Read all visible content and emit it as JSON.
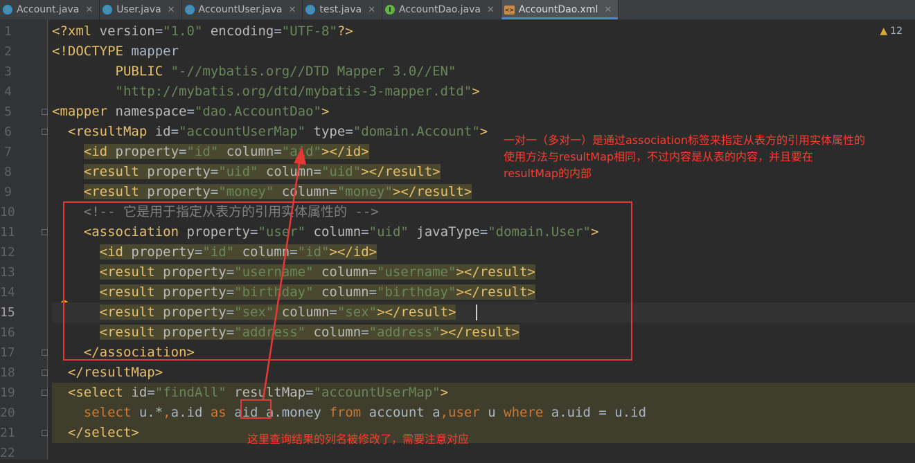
{
  "tabs": [
    {
      "label": "Account.java",
      "icon": "class-c-icon",
      "badge": "C"
    },
    {
      "label": "User.java",
      "icon": "class-c-icon",
      "badge": "C"
    },
    {
      "label": "AccountUser.java",
      "icon": "class-c-icon",
      "badge": "C"
    },
    {
      "label": "test.java",
      "icon": "class-c-icon",
      "badge": "C"
    },
    {
      "label": "AccountDao.java",
      "icon": "interface-i-icon",
      "badge": "I"
    },
    {
      "label": "AccountDao.xml",
      "icon": "xml-file-icon",
      "badge": "<>",
      "active": true
    }
  ],
  "close_glyph": "✕",
  "warnings": {
    "count": "12",
    "icon": "warning-triangle-icon"
  },
  "line_numbers": [
    "1",
    "2",
    "3",
    "4",
    "5",
    "6",
    "7",
    "8",
    "9",
    "10",
    "11",
    "12",
    "13",
    "14",
    "15",
    "16",
    "17",
    "18",
    "19",
    "20",
    "21",
    "22"
  ],
  "current_line": "15",
  "colors": {
    "tag": "#e8bf6a",
    "attr": "#bababa",
    "value": "#6a8759",
    "comment": "#808080",
    "keyword": "#cc7832",
    "text": "#a9b7c6",
    "annotation": "#ff3b30"
  },
  "code": [
    [
      [
        "t",
        "<?xml "
      ],
      [
        "a",
        "version"
      ],
      [
        "plain",
        "="
      ],
      [
        "v",
        "\"1.0\""
      ],
      [
        "a",
        " encoding"
      ],
      [
        "plain",
        "="
      ],
      [
        "v",
        "\"UTF-8\""
      ],
      [
        "t",
        "?>"
      ]
    ],
    [
      [
        "t",
        "<!DOCTYPE "
      ],
      [
        "plain",
        "mapper"
      ]
    ],
    [
      [
        "plain",
        "        "
      ],
      [
        "t",
        "PUBLIC "
      ],
      [
        "v",
        "\"-//mybatis.org//DTD Mapper 3.0//EN\""
      ]
    ],
    [
      [
        "plain",
        "        "
      ],
      [
        "v",
        "\"http://mybatis.org/dtd/mybatis-3-mapper.dtd\""
      ],
      [
        "t",
        ">"
      ]
    ],
    [
      [
        "t",
        "<mapper "
      ],
      [
        "a",
        "namespace"
      ],
      [
        "plain",
        "="
      ],
      [
        "v",
        "\"dao.AccountDao\""
      ],
      [
        "t",
        ">"
      ]
    ],
    [
      [
        "plain",
        "  "
      ],
      [
        "t",
        "<resultMap "
      ],
      [
        "a",
        "id"
      ],
      [
        "plain",
        "="
      ],
      [
        "v",
        "\"accountUserMap\""
      ],
      [
        "a",
        " type"
      ],
      [
        "plain",
        "="
      ],
      [
        "v",
        "\"domain.Account\""
      ],
      [
        "t",
        ">"
      ]
    ],
    [
      [
        "plain",
        "    "
      ],
      [
        "hl",
        [
          [
            "t",
            "<id "
          ],
          [
            "a",
            "property"
          ],
          [
            "plain",
            "="
          ],
          [
            "v",
            "\"id\""
          ],
          [
            "a",
            " column"
          ],
          [
            "plain",
            "="
          ],
          [
            "v",
            "\"aid\""
          ],
          [
            "t",
            "></id>"
          ]
        ]
      ]
    ],
    [
      [
        "plain",
        "    "
      ],
      [
        "hl",
        [
          [
            "t",
            "<result "
          ],
          [
            "a",
            "property"
          ],
          [
            "plain",
            "="
          ],
          [
            "v",
            "\"uid\""
          ],
          [
            "a",
            " column"
          ],
          [
            "plain",
            "="
          ],
          [
            "v",
            "\"uid\""
          ],
          [
            "t",
            "></result>"
          ]
        ]
      ]
    ],
    [
      [
        "plain",
        "    "
      ],
      [
        "hl",
        [
          [
            "t",
            "<result "
          ],
          [
            "a",
            "property"
          ],
          [
            "plain",
            "="
          ],
          [
            "v",
            "\"money\""
          ],
          [
            "a",
            " column"
          ],
          [
            "plain",
            "="
          ],
          [
            "v",
            "\"money\""
          ],
          [
            "t",
            "></result>"
          ]
        ]
      ]
    ],
    [
      [
        "plain",
        "    "
      ],
      [
        "c",
        "<!-- 它是用于指定从表方的引用实体属性的 -->"
      ]
    ],
    [
      [
        "plain",
        "    "
      ],
      [
        "t",
        "<association "
      ],
      [
        "a",
        "property"
      ],
      [
        "plain",
        "="
      ],
      [
        "v",
        "\"user\""
      ],
      [
        "a",
        " column"
      ],
      [
        "plain",
        "="
      ],
      [
        "v",
        "\"uid\""
      ],
      [
        "a",
        " javaType"
      ],
      [
        "plain",
        "="
      ],
      [
        "v",
        "\"domain.User\""
      ],
      [
        "t",
        ">"
      ]
    ],
    [
      [
        "plain",
        "      "
      ],
      [
        "hl",
        [
          [
            "t",
            "<id "
          ],
          [
            "a",
            "property"
          ],
          [
            "plain",
            "="
          ],
          [
            "v",
            "\"id\""
          ],
          [
            "a",
            " column"
          ],
          [
            "plain",
            "="
          ],
          [
            "v",
            "\"id\""
          ],
          [
            "t",
            "></id>"
          ]
        ]
      ]
    ],
    [
      [
        "plain",
        "      "
      ],
      [
        "hl",
        [
          [
            "t",
            "<result "
          ],
          [
            "a",
            "property"
          ],
          [
            "plain",
            "="
          ],
          [
            "v",
            "\"username\""
          ],
          [
            "a",
            " column"
          ],
          [
            "plain",
            "="
          ],
          [
            "v",
            "\"username\""
          ],
          [
            "t",
            "></result>"
          ]
        ]
      ]
    ],
    [
      [
        "plain",
        "      "
      ],
      [
        "hl",
        [
          [
            "t",
            "<result "
          ],
          [
            "a",
            "property"
          ],
          [
            "plain",
            "="
          ],
          [
            "v",
            "\"birthday\""
          ],
          [
            "a",
            " column"
          ],
          [
            "plain",
            "="
          ],
          [
            "v",
            "\"birthday\""
          ],
          [
            "t",
            "></result>"
          ]
        ]
      ]
    ],
    [
      [
        "plain",
        "      "
      ],
      [
        "hl",
        [
          [
            "t",
            "<result "
          ],
          [
            "a",
            "property"
          ],
          [
            "plain",
            "="
          ],
          [
            "v",
            "\"sex\""
          ],
          [
            "a",
            " column"
          ],
          [
            "plain",
            "="
          ],
          [
            "v",
            "\"sex\""
          ],
          [
            "t",
            "></result>"
          ]
        ]
      ]
    ],
    [
      [
        "plain",
        "      "
      ],
      [
        "hl",
        [
          [
            "t",
            "<result "
          ],
          [
            "a",
            "property"
          ],
          [
            "plain",
            "="
          ],
          [
            "v",
            "\"address\""
          ],
          [
            "a",
            " column"
          ],
          [
            "plain",
            "="
          ],
          [
            "v",
            "\"address\""
          ],
          [
            "t",
            "></result>"
          ]
        ]
      ]
    ],
    [
      [
        "plain",
        "    "
      ],
      [
        "t",
        "</association>"
      ]
    ],
    [
      [
        "plain",
        "  "
      ],
      [
        "t",
        "</resultMap>"
      ]
    ],
    [
      [
        "plain",
        "  "
      ],
      [
        "t",
        "<select "
      ],
      [
        "a",
        "id"
      ],
      [
        "plain",
        "="
      ],
      [
        "v",
        "\"findAll\""
      ],
      [
        "a",
        " resultMap"
      ],
      [
        "plain",
        "="
      ],
      [
        "v",
        "\"accountUserMap\""
      ],
      [
        "t",
        ">"
      ]
    ],
    [
      [
        "plain",
        "    "
      ],
      [
        "k",
        "select "
      ],
      [
        "plain",
        "u.*"
      ],
      [
        "k",
        ","
      ],
      [
        "plain",
        "a.id "
      ],
      [
        "k",
        "as "
      ],
      [
        "plain",
        "aid a.money "
      ],
      [
        "k",
        "from "
      ],
      [
        "plain",
        "account a"
      ],
      [
        "k",
        ","
      ],
      [
        "k",
        "user "
      ],
      [
        "plain",
        "u "
      ],
      [
        "k",
        "where "
      ],
      [
        "plain",
        "a.uid = u.id"
      ]
    ],
    [
      [
        "plain",
        "  "
      ],
      [
        "t",
        "</select>"
      ]
    ],
    [
      [
        "plain",
        ""
      ]
    ]
  ],
  "annotations": {
    "right_note_lines": [
      "一对一（多对一）是通过association标签来指定从表方的引用实体属性的",
      "使用方法与resultMap相同，不过内容是从表的内容，并且要在",
      "resultMap的内部"
    ],
    "bottom_note": "这里查询结果的列名被修改了，需要注意对应"
  }
}
